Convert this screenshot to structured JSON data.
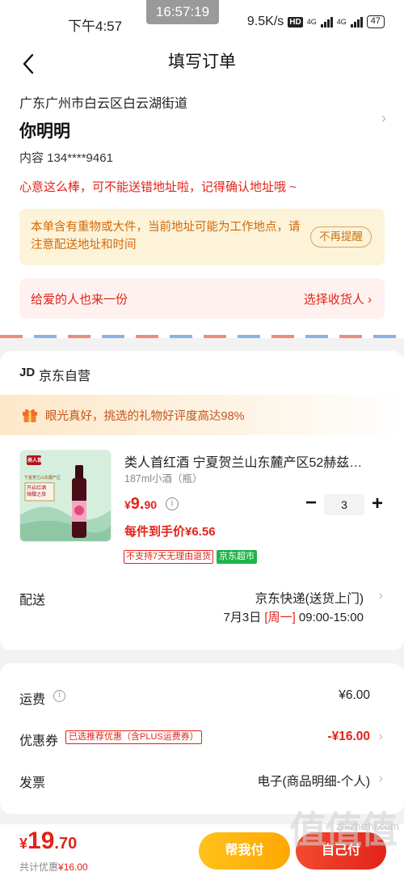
{
  "status_bar": {
    "time": "下午4:57",
    "clock": "16:57:19",
    "network_speed": "9.5K/s",
    "hd_label": "HD",
    "sig1_label": "4G",
    "sig2_label": "4G",
    "battery": "47"
  },
  "nav": {
    "title": "填写订单",
    "back_icon": "chevron-left-icon"
  },
  "address": {
    "region": "广东广州市白云区白云湖街道",
    "name": "你明明",
    "phone": "内容  134****9461",
    "tip": "心意这么棒，可不能送错地址啦，记得确认地址哦 ~",
    "warning": "本单含有重物或大件，当前地址可能为工作地点，请注意配送地址和时间",
    "warning_button": "不再提醒",
    "gift_text": "给爱的人也来一份",
    "gift_action": "选择收货人 ›"
  },
  "order": {
    "shop_logo": "JD",
    "shop_name": "京东自营",
    "praise": "眼光真好，挑选的礼物好评度高达98%",
    "product": {
      "title": "类人首红酒 宁夏贺兰山东麓产区52赫兹…",
      "spec": "187ml小酒（瓶）",
      "price_currency": "¥",
      "price_int": "9.",
      "price_dec": "90",
      "unit_price": "每件到手价¥6.56",
      "quantity": "3",
      "tag_noreturn": "不支持7天无理由退货",
      "tag_market": "京东超市",
      "img_label_top": "类人首",
      "img_label_region": "宁夏贺兰山东麓产区",
      "img_label_box": "开启红酒\n微醺之旅"
    },
    "delivery": {
      "label": "配送",
      "method": "京东快递(送货上门)",
      "date": "7月3日 ",
      "weekday": "[周一]",
      "time": " 09:00-15:00"
    }
  },
  "fees": {
    "freight_label": "运费",
    "freight_value": "¥6.00",
    "coupon_label": "优惠券",
    "coupon_tag": "已选推荐优惠（含PLUS运费券）",
    "coupon_value": "-¥16.00",
    "invoice_label": "发票",
    "invoice_value": "电子(商品明细-个人)"
  },
  "bottom": {
    "total_currency": "¥",
    "total_int": "19",
    "total_dec": ".70",
    "sub_label": "共计优惠",
    "sub_value": "¥16.00",
    "help_button": "帮我付",
    "self_button": "自己付",
    "watermark": "zhizhizhi.com",
    "watermark_logo": "值值值"
  },
  "colors": {
    "accent": "#e2231a",
    "warning": "#d26a0a",
    "help": "#ffb400",
    "market": "#1fb44a"
  }
}
